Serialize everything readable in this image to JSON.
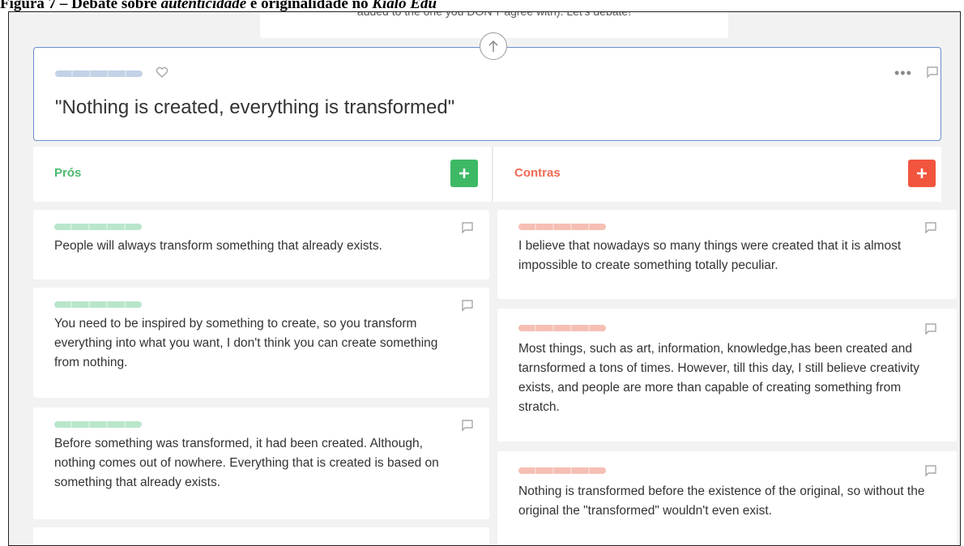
{
  "figure_caption": {
    "prefix": "Figura 7 – Debate sobre ",
    "italic1": "autenticidade",
    "middle": " e originalidade no ",
    "italic2": "Kialo Edu"
  },
  "top_card": {
    "text": "added to the one you DON'T agree with). Let's debate!"
  },
  "claim": {
    "text": "\"Nothing is created, everything is transformed\""
  },
  "columns": {
    "pros": {
      "title": "Prós"
    },
    "cons": {
      "title": "Contras"
    }
  },
  "pros": [
    {
      "text": "People will always transform something that already exists."
    },
    {
      "text": "You need to be inspired by something to create, so you transform everything into what you want, I don't think you can create something from nothing."
    },
    {
      "text": "Before something was transformed, it had been created. Although, nothing comes out of nowhere. Everything that is created is based on something that already exists."
    }
  ],
  "cons": [
    {
      "text": "I believe that nowadays so many things were created that it is almost impossible to create something totally peculiar."
    },
    {
      "text": "Most things, such as art, information, knowledge,has been created and tarnsformed a tons of times. However, till this day, I still believe creativity exists, and people are more than capable of creating something from stratch."
    },
    {
      "text": "Nothing is transformed before the existence of the original, so without the original the \"transformed\" wouldn't even exist."
    }
  ],
  "colors": {
    "pro": "#3db865",
    "con": "#f2553e",
    "accent": "#6b8dc9"
  },
  "icons": [
    "heart-icon",
    "more-icon",
    "comment-icon",
    "plus-icon",
    "arrow-up-icon"
  ]
}
